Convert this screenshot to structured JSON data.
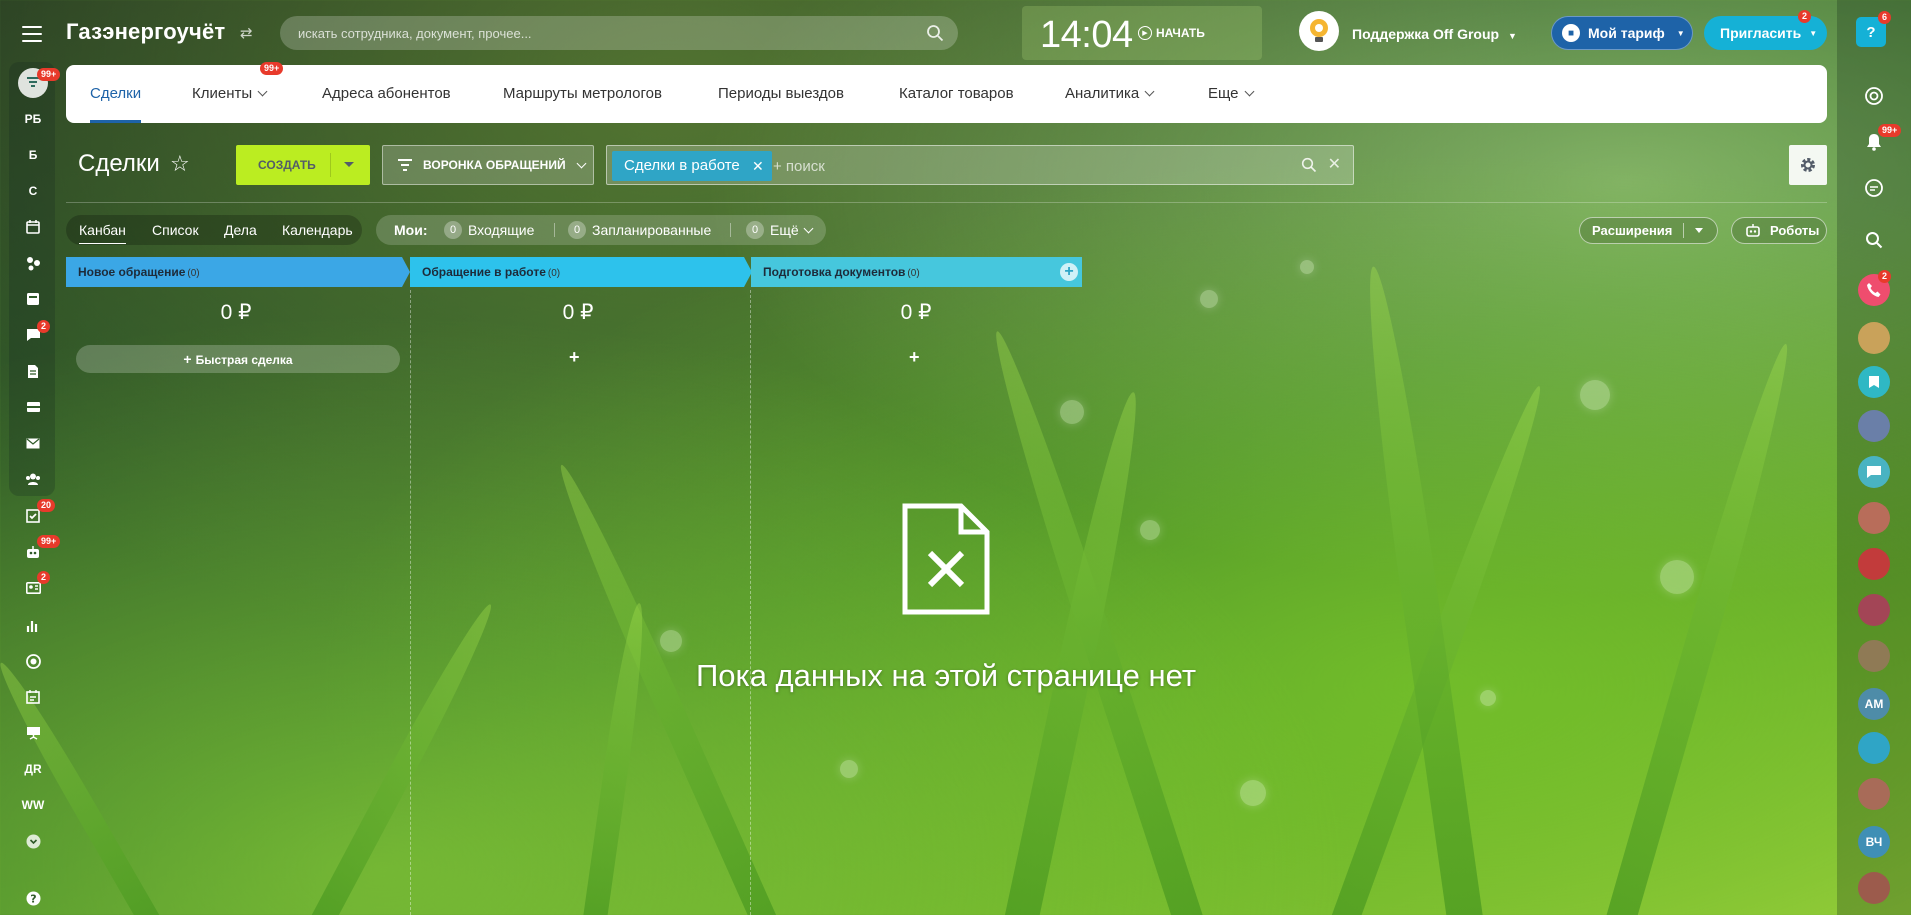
{
  "app": {
    "logo": "Газэнергоучёт",
    "search_placeholder": "искать сотрудника, документ, прочее...",
    "clock": "14:04",
    "clock_start": "НАЧАТЬ",
    "support_name": "Поддержка Off Group",
    "tariff_label": "Мой тариф",
    "invite_label": "Пригласить",
    "invite_badge": "2",
    "help_badge": "6"
  },
  "left_nav": {
    "items": [
      {
        "name": "filter",
        "label": "",
        "icon": "funnel-icon",
        "badge": "99+"
      },
      {
        "name": "rb",
        "label": "РБ",
        "badge": ""
      },
      {
        "name": "b",
        "label": "Б",
        "badge": ""
      },
      {
        "name": "s",
        "label": "С",
        "badge": ""
      },
      {
        "name": "calendar",
        "label": "",
        "icon": "calendar-icon",
        "badge": ""
      },
      {
        "name": "workflow",
        "label": "",
        "icon": "workflow-icon",
        "badge": ""
      },
      {
        "name": "feed",
        "label": "",
        "icon": "feed-icon",
        "badge": ""
      },
      {
        "name": "chat",
        "label": "",
        "icon": "chat-icon",
        "badge": "2"
      },
      {
        "name": "docs",
        "label": "",
        "icon": "document-icon",
        "badge": ""
      },
      {
        "name": "inbox",
        "label": "",
        "icon": "inbox-icon",
        "badge": ""
      },
      {
        "name": "mail",
        "label": "",
        "icon": "mail-icon",
        "badge": ""
      },
      {
        "name": "employees",
        "label": "",
        "icon": "people-icon",
        "badge": ""
      },
      {
        "name": "tasks",
        "label": "",
        "icon": "tasks-icon",
        "badge": "20"
      },
      {
        "name": "crm",
        "label": "",
        "icon": "robot-icon",
        "badge": "99+"
      },
      {
        "name": "contacts",
        "label": "",
        "icon": "contact-card-icon",
        "badge": "2"
      },
      {
        "name": "analytics",
        "label": "",
        "icon": "analytics-icon",
        "badge": ""
      },
      {
        "name": "target",
        "label": "",
        "icon": "target-icon",
        "badge": ""
      },
      {
        "name": "schedule",
        "label": "",
        "icon": "schedule-icon",
        "badge": ""
      },
      {
        "name": "presentation",
        "label": "",
        "icon": "presentation-icon",
        "badge": ""
      },
      {
        "name": "dr",
        "label": "ДR",
        "badge": ""
      },
      {
        "name": "ww",
        "label": "WW",
        "badge": ""
      },
      {
        "name": "more",
        "label": "",
        "icon": "chevron-down-icon",
        "badge": ""
      },
      {
        "name": "help",
        "label": "",
        "icon": "help-icon",
        "badge": ""
      }
    ]
  },
  "right_nav": {
    "notification_badge": "99+",
    "call_badge": "2",
    "avatar_initials": [
      "АМ",
      "ВЧ"
    ]
  },
  "tabs": [
    {
      "label": "Сделки",
      "active": true,
      "dropdown": false,
      "badge": ""
    },
    {
      "label": "Клиенты",
      "active": false,
      "dropdown": true,
      "badge": "99+"
    },
    {
      "label": "Адреса абонентов",
      "active": false,
      "dropdown": false,
      "badge": ""
    },
    {
      "label": "Маршруты метрологов",
      "active": false,
      "dropdown": false,
      "badge": ""
    },
    {
      "label": "Периоды выездов",
      "active": false,
      "dropdown": false,
      "badge": ""
    },
    {
      "label": "Каталог товаров",
      "active": false,
      "dropdown": false,
      "badge": ""
    },
    {
      "label": "Аналитика",
      "active": false,
      "dropdown": true,
      "badge": ""
    },
    {
      "label": "Еще",
      "active": false,
      "dropdown": true,
      "badge": ""
    }
  ],
  "toolbar": {
    "title": "Сделки",
    "create_label": "СОЗДАТЬ",
    "funnel_label": "ВОРОНКА ОБРАЩЕНИЙ",
    "filter_chip": "Сделки в работе",
    "filter_placeholder": "+ поиск"
  },
  "views": {
    "items": [
      "Канбан",
      "Список",
      "Дела",
      "Календарь"
    ],
    "active": "Канбан"
  },
  "counters": {
    "label": "Мои:",
    "items": [
      {
        "count": "0",
        "label": "Входящие"
      },
      {
        "count": "0",
        "label": "Запланированные"
      },
      {
        "count": "0",
        "label": "Ещё"
      }
    ]
  },
  "extensions_label": "Расширения",
  "robots_label": "Роботы",
  "columns": [
    {
      "title": "Новое обращение",
      "count": "(0)",
      "color": "#3ba7e6",
      "sum": "0 ₽",
      "action": "Быстрая сделка"
    },
    {
      "title": "Обращение в работе",
      "count": "(0)",
      "color": "#2dc2ec",
      "sum": "0 ₽",
      "action": "+"
    },
    {
      "title": "Подготовка документов",
      "count": "(0)",
      "color": "#46c7dd",
      "sum": "0 ₽",
      "action": "+"
    }
  ],
  "empty_state": {
    "text": "Пока данных на этой странице нет"
  }
}
